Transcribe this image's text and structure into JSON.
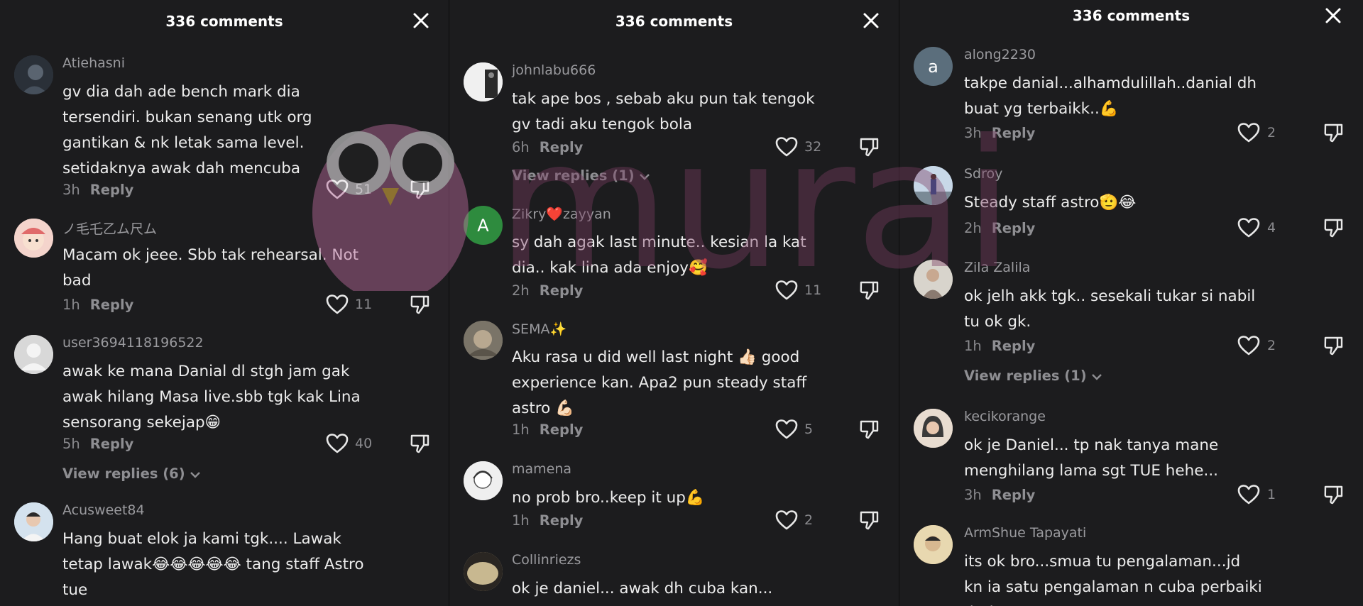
{
  "panels": [
    {
      "title": "336 comments",
      "comments": [
        {
          "username": "Atiehasni",
          "text": "gv dia dah ade bench mark dia tersendiri. bukan senang utk org gantikan & nk letak sama level. setidaknya awak dah mencuba",
          "time": "3h",
          "reply": "Reply",
          "likes": "51",
          "view_replies": "",
          "avatar_color": "#3a4250",
          "avatar_letter": ""
        },
        {
          "username": "ノ毛乇乙ム尺ム",
          "text": "Macam ok jeee. Sbb tak rehearsal. Not bad",
          "time": "1h",
          "reply": "Reply",
          "likes": "11",
          "view_replies": "",
          "avatar_color": "#e8a8a8",
          "avatar_letter": ""
        },
        {
          "username": "user3694118196522",
          "text": "awak ke mana Danial dl stgh jam gak awak hilang Masa live.sbb tgk kak Lina sensorang sekejap😁",
          "time": "5h",
          "reply": "Reply",
          "likes": "40",
          "view_replies": "View replies (6)",
          "avatar_color": "#d8d8d8",
          "avatar_letter": ""
        },
        {
          "username": "Acusweet84",
          "text": "Hang buat elok ja kami tgk.... Lawak tetap lawak😂😂😂😂😂 tang staff Astro tue",
          "time": "",
          "reply": "",
          "likes": "",
          "view_replies": "",
          "avatar_color": "#a8c0d8",
          "avatar_letter": ""
        }
      ]
    },
    {
      "title": "336 comments",
      "comments": [
        {
          "username": "johnlabu666",
          "text": "tak ape bos , sebab aku pun tak tengok gv tadi aku tengok bola",
          "time": "6h",
          "reply": "Reply",
          "likes": "32",
          "view_replies": "View replies (1)",
          "avatar_color": "#6a6a6a",
          "avatar_letter": ""
        },
        {
          "username": "Zikry❤️zayyan",
          "text": "sy dah agak last minute.. kesian la kat dia.. kak lina ada enjoy🥰",
          "time": "2h",
          "reply": "Reply",
          "likes": "11",
          "view_replies": "",
          "avatar_color": "#2e8b3e",
          "avatar_letter": "A"
        },
        {
          "username": "SEMA✨",
          "text": "Aku rasa u did well last night 👍🏻 good experience kan. Apa2 pun steady staff astro 💪🏻",
          "time": "1h",
          "reply": "Reply",
          "likes": "5",
          "view_replies": "",
          "avatar_color": "#8a8070",
          "avatar_letter": ""
        },
        {
          "username": "mamena",
          "text": "no prob bro..keep it up💪",
          "time": "1h",
          "reply": "Reply",
          "likes": "2",
          "view_replies": "",
          "avatar_color": "#e0e0e0",
          "avatar_letter": ""
        },
        {
          "username": "Collinriezs",
          "text": "ok je daniel... awak dh cuba kan...",
          "time": "",
          "reply": "",
          "likes": "",
          "view_replies": "",
          "avatar_color": "#c8b890",
          "avatar_letter": ""
        }
      ]
    },
    {
      "title": "336 comments",
      "comments": [
        {
          "username": "along2230",
          "text": "takpe danial...alhamdulillah..danial dh buat yg terbaikk..💪",
          "time": "3h",
          "reply": "Reply",
          "likes": "2",
          "view_replies": "",
          "avatar_color": "#5b6e7c",
          "avatar_letter": "a"
        },
        {
          "username": "Sdroy",
          "text": "Steady staff astro🫡😂",
          "time": "2h",
          "reply": "Reply",
          "likes": "4",
          "view_replies": "",
          "avatar_color": "#8aa0b8",
          "avatar_letter": ""
        },
        {
          "username": "Zila Zalila",
          "text": "ok jelh akk tgk.. sesekali tukar si nabil tu ok gk.",
          "time": "1h",
          "reply": "Reply",
          "likes": "2",
          "view_replies": "View replies (1)",
          "avatar_color": "#b0a8a0",
          "avatar_letter": ""
        },
        {
          "username": "kecikorange",
          "text": "ok je Daniel... tp nak tanya mane menghilang lama sgt TUE hehe...",
          "time": "3h",
          "reply": "Reply",
          "likes": "1",
          "view_replies": "",
          "avatar_color": "#d8c8b8",
          "avatar_letter": ""
        },
        {
          "username": "ArmShue Tapayati",
          "text": "its ok bro...smua tu pengalaman...jd kn ia satu pengalaman n cuba perbaiki dari",
          "time": "",
          "reply": "",
          "likes": "",
          "view_replies": "",
          "avatar_color": "#c8a870",
          "avatar_letter": ""
        }
      ]
    }
  ],
  "watermark_text": "murai",
  "icons": {
    "close": "close-icon",
    "like": "heart-outline-icon",
    "dislike": "thumbs-down-icon",
    "chevron": "chevron-down-icon"
  }
}
